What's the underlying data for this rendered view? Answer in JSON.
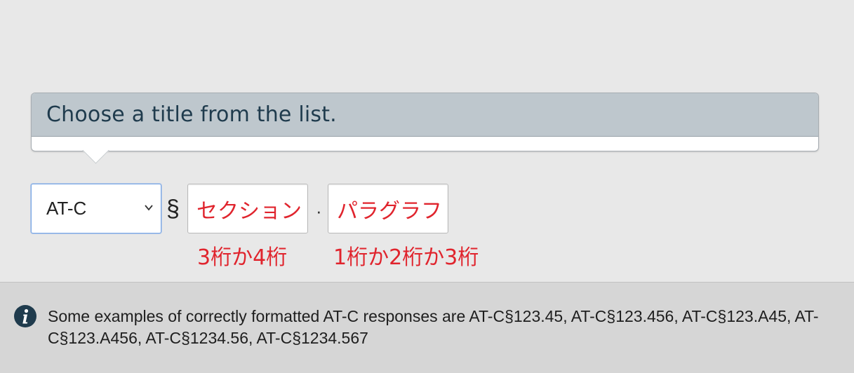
{
  "tooltip": {
    "message": "Choose a title from the list."
  },
  "title_select": {
    "value": "AT-C"
  },
  "section_sign": "§",
  "section_field": {
    "placeholder": "セクション",
    "hint": "3桁か4桁"
  },
  "separator": "·",
  "paragraph_field": {
    "placeholder": "パラグラフ",
    "hint": "1桁か2桁か3桁"
  },
  "info": {
    "icon": "info-icon",
    "text": "Some examples of correctly formatted AT-C responses are AT-C§123.45, AT-C§123.456, AT-C§123.A45, AT-C§123.A456, AT-C§1234.56, AT-C§1234.567"
  },
  "colors": {
    "hint_red": "#e0242d",
    "tooltip_header": "#bec7cd",
    "info_icon": "#1f3b4d"
  }
}
